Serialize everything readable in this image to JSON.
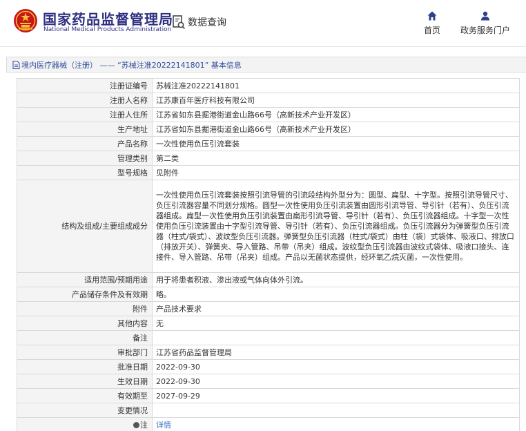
{
  "header": {
    "title_cn": "国家药品监督管理局",
    "title_en": "National Medical Products Administration",
    "query_label": "数据查询",
    "nav": [
      {
        "label": "首页",
        "icon": "home-icon"
      },
      {
        "label": "政务服务门户",
        "icon": "user-icon"
      }
    ]
  },
  "breadcrumb": {
    "text": "境内医疗器械（注册） —— “苏械注准20222141801” 基本信息"
  },
  "colors": {
    "brand": "#2f2f82",
    "link": "#3a6fc4",
    "label_bg": "#f4f4f4",
    "border": "#d9d9d9",
    "logo_red": "#c8161d"
  },
  "rows": [
    {
      "label": "注册证编号",
      "value": "苏械注准20222141801"
    },
    {
      "label": "注册人名称",
      "value": "江苏康百年医疗科技有限公司"
    },
    {
      "label": "注册人住所",
      "value": "江苏省如东县掘港街道金山路66号（高新技术产业开发区）"
    },
    {
      "label": "生产地址",
      "value": "江苏省如东县掘港街道金山路66号（高新技术产业开发区）"
    },
    {
      "label": "产品名称",
      "value": "一次性使用负压引流套装"
    },
    {
      "label": "管理类别",
      "value": "第二类"
    },
    {
      "label": "型号规格",
      "value": "见附件"
    },
    {
      "label": "结构及组成/主要组成成分",
      "value": "一次性使用负压引流套装按照引流导管的引流段结构外型分为：圆型、扁型、十字型。按照引流导管尺寸、负压引流器容量不同划分规格。圆型一次性使用负压引流装置由圆形引流导管、导引针（若有）、负压引流器组成。扁型一次性使用负压引流装置由扁形引流导管、导引针（若有）、负压引流器组成。十字型一次性使用负压引流装置由十字型引流导管、导引针（若有）、负压引流器组成。负压引流器分为弹簧型负压引流器（柱式/袋式）、波纹型负压引流器。弹簧型负压引流器（柱式/袋式）由柱（袋）式袋体、吸液口、排放口（排放开关）、弹簧夹、导入管路、吊带（吊夹）组成。波纹型负压引流器由波纹式袋体、吸液口接头、连接件、导入管路、吊带（吊夹）组成。产品以无菌状态提供，经环氧乙烷灭菌，一次性使用。"
    },
    {
      "label": "适用范围/预期用途",
      "value": "用于将患者积液、渗出液或气体向体外引流。"
    },
    {
      "label": "产品储存条件及有效期",
      "value": "略。"
    },
    {
      "label": "附件",
      "value": "产品技术要求"
    },
    {
      "label": "其他内容",
      "value": "无"
    },
    {
      "label": "备注",
      "value": ""
    },
    {
      "label": "审批部门",
      "value": "江苏省药品监督管理局"
    },
    {
      "label": "批准日期",
      "value": "2022-09-30"
    },
    {
      "label": "生效日期",
      "value": "2022-09-30"
    },
    {
      "label": "有效期至",
      "value": "2027-09-29"
    },
    {
      "label": "变更情况",
      "value": ""
    },
    {
      "label": "注",
      "value": "详情",
      "icon": "note-icon"
    }
  ]
}
